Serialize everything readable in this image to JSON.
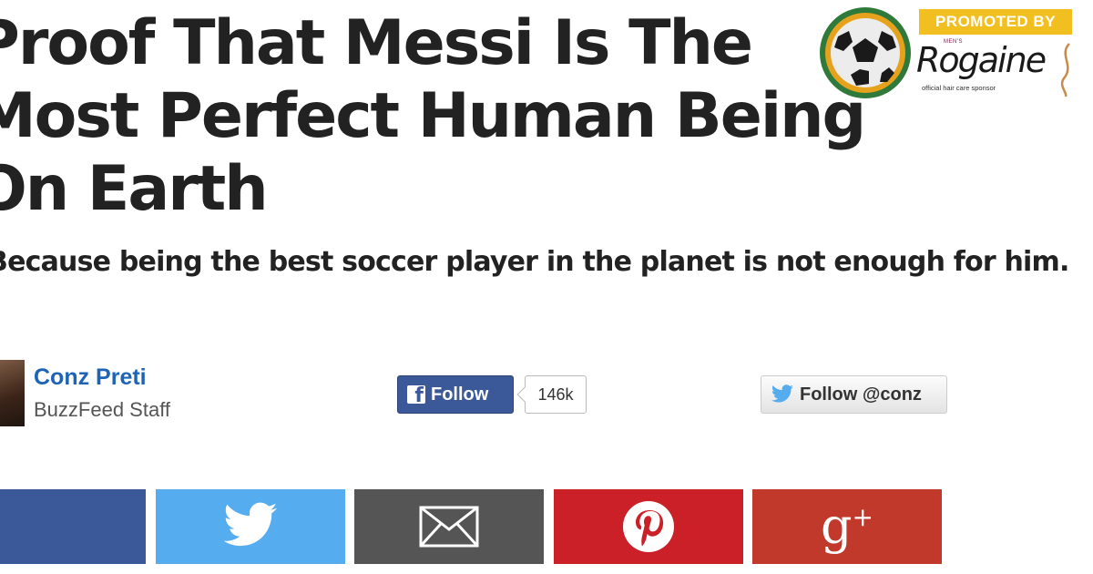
{
  "article": {
    "title_lines": [
      "Proof That Messi Is The",
      "Most Perfect Human Being",
      "On Earth"
    ],
    "subtitle": "Because being the best soccer player in the planet is not enough for him."
  },
  "sponsor": {
    "promoted_label": "PROMOTED BY",
    "brand_small": "MEN'S",
    "brand_name": "Rogaine",
    "tagline": "official hair care sponsor",
    "icon": "soccer-ball-icon"
  },
  "author": {
    "name": "Conz Preti",
    "role": "BuzzFeed Staff"
  },
  "social_follow": {
    "facebook_label": "Follow",
    "facebook_count": "146k",
    "twitter_label": "Follow @conz"
  },
  "share_bar": [
    {
      "network": "facebook",
      "icon": "facebook-icon",
      "color": "#3b5998"
    },
    {
      "network": "twitter",
      "icon": "twitter-bird-icon",
      "color": "#55acee"
    },
    {
      "network": "email",
      "icon": "envelope-icon",
      "color": "#555555"
    },
    {
      "network": "pinterest",
      "icon": "pinterest-icon",
      "color": "#cb2027"
    },
    {
      "network": "google-plus",
      "icon": "google-plus-icon",
      "label": "g+",
      "color": "#c1392b"
    }
  ]
}
